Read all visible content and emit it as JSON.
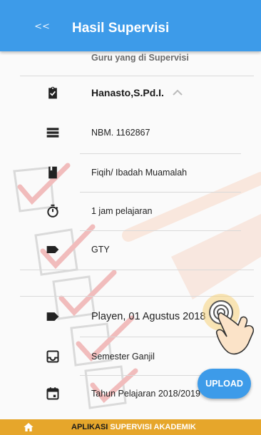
{
  "header": {
    "back_label": "<<",
    "title": "Hasil Supervisi"
  },
  "list": {
    "section_label": "Guru yang di Supervisi",
    "teacher_name": "Hanasto,S.Pd.I.",
    "nbm": "NBM. 1162867",
    "subject": "Fiqih/ Ibadah Muamalah",
    "duration": "1 jam pelajaran",
    "status": "GTY",
    "place_date": "Playen, 01 Agustus 2018",
    "semester": "Semester Ganjil",
    "year": "Tahun Pelajaran 2018/2019"
  },
  "upload_label": "UPLOAD",
  "footer": {
    "part1": "APLIKASI",
    "part2": "SUPERVISI AKADEMIK"
  },
  "colors": {
    "appbar": "#3d9be9",
    "footer": "#e6a62b",
    "accent": "#3d9be9"
  }
}
